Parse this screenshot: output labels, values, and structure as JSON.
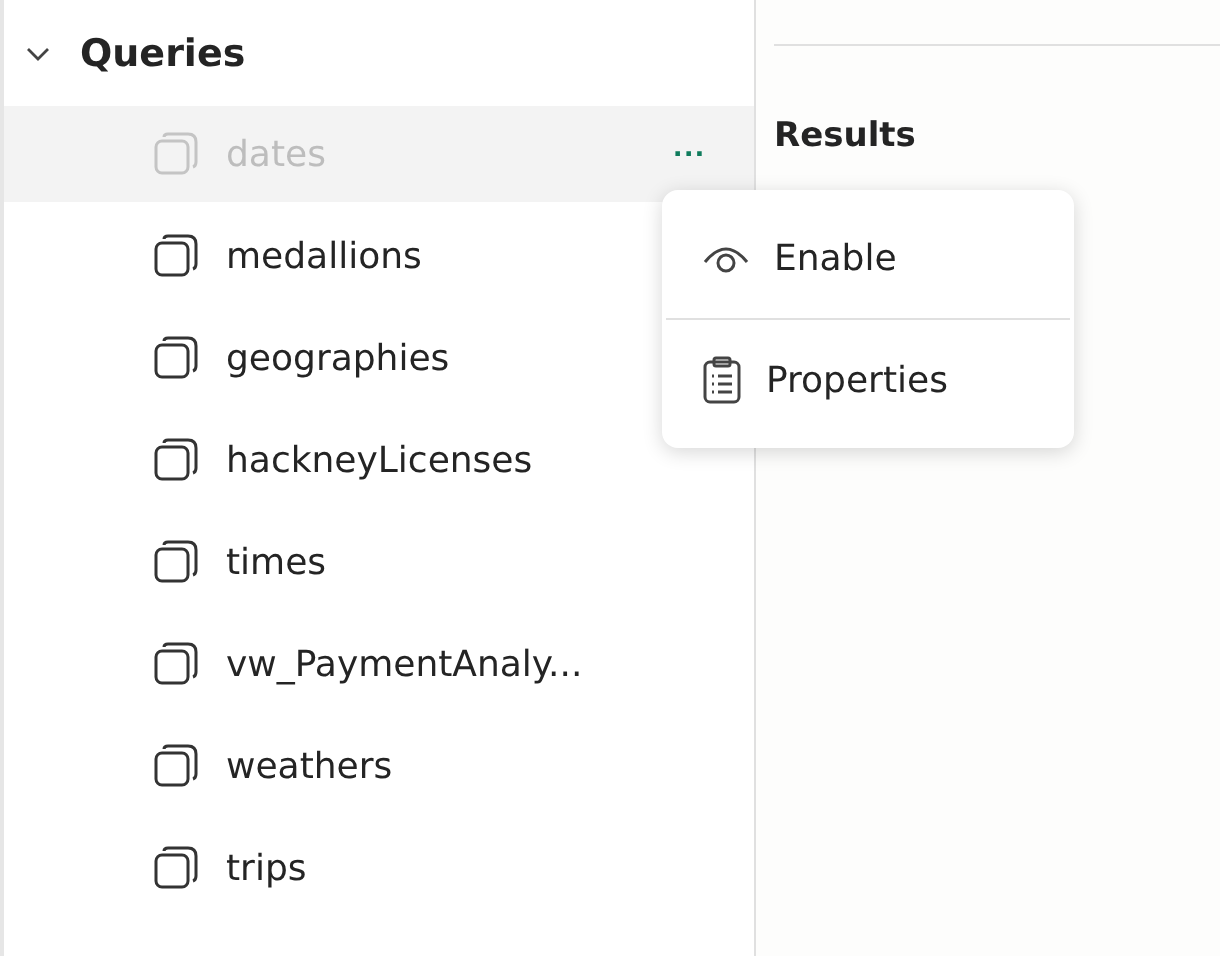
{
  "queries": {
    "title": "Queries",
    "expanded": true,
    "items": [
      {
        "label": "dates",
        "disabled": true,
        "selected": true
      },
      {
        "label": "medallions",
        "disabled": false,
        "selected": false
      },
      {
        "label": "geographies",
        "disabled": false,
        "selected": false
      },
      {
        "label": "hackneyLicenses",
        "disabled": false,
        "selected": false
      },
      {
        "label": "times",
        "disabled": false,
        "selected": false
      },
      {
        "label": "vw_PaymentAnaly...",
        "disabled": false,
        "selected": false
      },
      {
        "label": "weathers",
        "disabled": false,
        "selected": false
      },
      {
        "label": "trips",
        "disabled": false,
        "selected": false
      }
    ],
    "more_button": "..."
  },
  "context_menu": {
    "items": [
      {
        "kind": "enable",
        "label": "Enable"
      },
      {
        "kind": "properties",
        "label": "Properties"
      }
    ]
  },
  "results": {
    "title": "Results"
  }
}
